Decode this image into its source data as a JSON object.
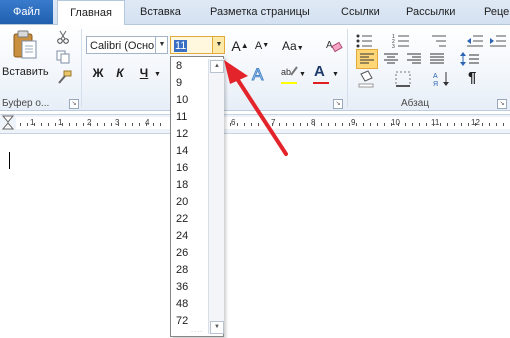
{
  "tabs": {
    "file": "Файл",
    "home": "Главная",
    "insert": "Вставка",
    "layout": "Разметка страницы",
    "links": "Ссылки",
    "mailings": "Рассылки",
    "review": "Реце"
  },
  "clipboard": {
    "paste": "Вставить",
    "group": "Буфер о..."
  },
  "font": {
    "name": "Calibri (Осно",
    "size": "11",
    "grow": "A",
    "shrink": "A",
    "case": "Aa",
    "bold": "Ж",
    "italic": "К",
    "underline": "Ч",
    "highlight_color": "#ffff00",
    "font_color": "#e02020"
  },
  "paragraph": {
    "group": "Абзац",
    "pilcrow": "¶"
  },
  "ruler": {
    "left_numbers": [
      "1",
      "1",
      "2",
      "3",
      "4"
    ],
    "right_numbers": [
      "6",
      "7",
      "8",
      "9",
      "10",
      "11",
      "12"
    ]
  },
  "font_size_list": [
    "8",
    "9",
    "10",
    "11",
    "12",
    "14",
    "16",
    "18",
    "20",
    "22",
    "24",
    "26",
    "28",
    "36",
    "48",
    "72"
  ],
  "annotation": {
    "arrow_color": "#e3242b"
  }
}
